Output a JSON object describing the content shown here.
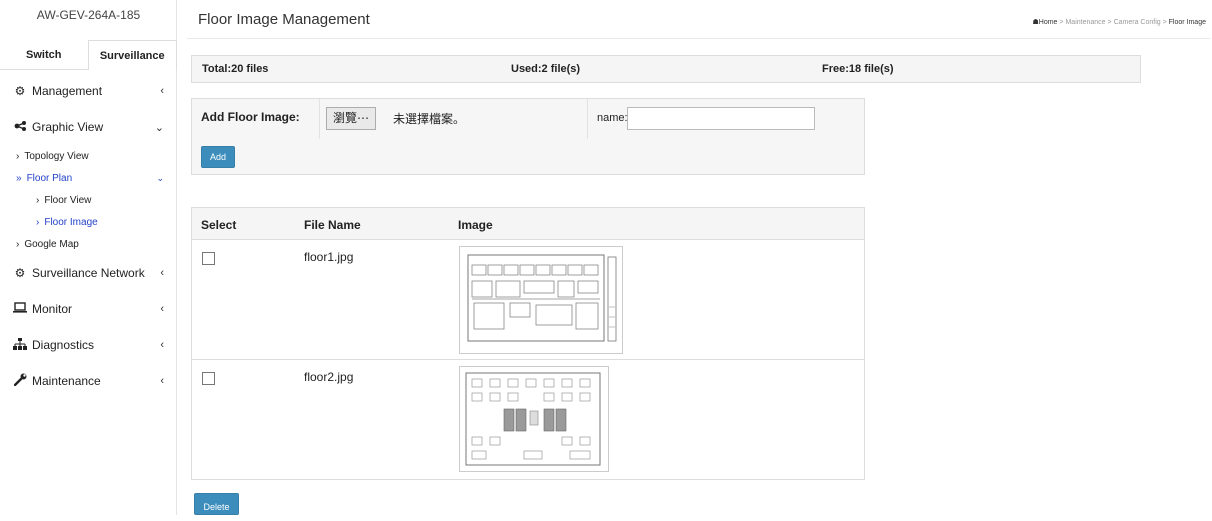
{
  "sidebar": {
    "device_title": "AW-GEV-264A-185",
    "tabs": [
      {
        "label": "Switch"
      },
      {
        "label": "Surveillance"
      }
    ],
    "nav": {
      "management": {
        "label": "Management",
        "icon": "gear-icon"
      },
      "graphic_view": {
        "label": "Graphic View",
        "icon": "share-icon"
      },
      "topology_view": {
        "label": "Topology View"
      },
      "floor_plan": {
        "label": "Floor Plan"
      },
      "floor_view": {
        "label": "Floor View"
      },
      "floor_image": {
        "label": "Floor Image"
      },
      "google_map": {
        "label": "Google Map"
      },
      "surveillance_network": {
        "label": "Surveillance Network",
        "icon": "cogs-icon"
      },
      "monitor": {
        "label": "Monitor",
        "icon": "laptop-icon"
      },
      "diagnostics": {
        "label": "Diagnostics",
        "icon": "sitemap-icon"
      },
      "maintenance": {
        "label": "Maintenance",
        "icon": "wrench-icon"
      }
    }
  },
  "header": {
    "title": "Floor Image Management",
    "breadcrumb": [
      "Home",
      "Maintenance",
      "Camera Config",
      "Floor Image"
    ]
  },
  "stats": {
    "total": "Total:20 files",
    "used": "Used:2 file(s)",
    "free": "Free:18 file(s)"
  },
  "add_form": {
    "label": "Add Floor Image:",
    "browse_label": "瀏覽⋯",
    "no_file_text": "未選擇檔案。",
    "name_label": "name:",
    "name_value": "",
    "add_label": "Add"
  },
  "table": {
    "headers": {
      "select": "Select",
      "file_name": "File Name",
      "image": "Image"
    },
    "rows": [
      {
        "file_name": "floor1.jpg",
        "checked": false
      },
      {
        "file_name": "floor2.jpg",
        "checked": false
      }
    ]
  },
  "delete_label": "Delete",
  "colors": {
    "accent": "#3c8dbc",
    "active_link": "#2441c8"
  }
}
